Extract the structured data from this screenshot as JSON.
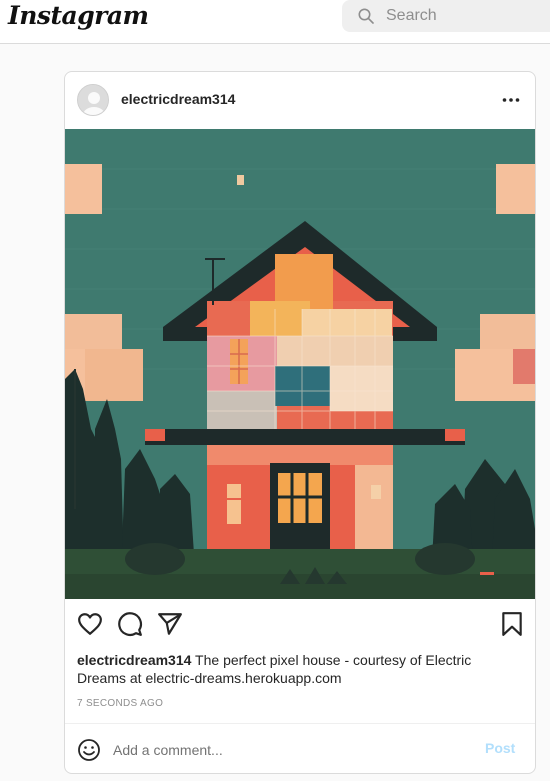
{
  "header": {
    "logo_text": "Instagram",
    "search_placeholder": "Search"
  },
  "post": {
    "username": "electricdream314",
    "caption_user": "electricdream314",
    "caption_text": " The perfect pixel house - courtesy of Electric Dreams at electric-dreams.herokuapp.com",
    "timestamp": "7 SECONDS AGO",
    "comment_placeholder": "Add a comment...",
    "post_label": "Post",
    "image_icon": "pixel-house-illustration"
  },
  "icons": {
    "search": "search-icon",
    "more": "more-options-icon",
    "like": "heart-icon",
    "comment": "comment-bubble-icon",
    "share": "paper-plane-icon",
    "save": "bookmark-icon",
    "emoji": "smiley-icon"
  },
  "colors": {
    "background": "#fafafa",
    "border": "#dbdbdb",
    "text": "#262626",
    "muted": "#8e8e8e",
    "post_button": "#b2dffc",
    "image_sky": "#3f7a6f",
    "image_roof": "#1e2a2a",
    "image_warm": "#e8604a"
  }
}
